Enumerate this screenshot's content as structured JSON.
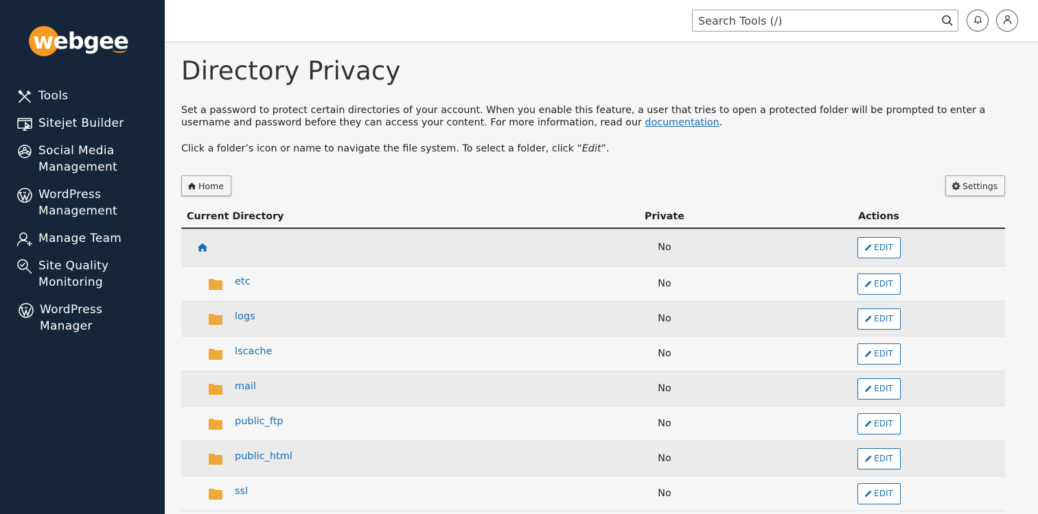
{
  "brand": {
    "name": "webgee",
    "accent": "#f59a23"
  },
  "sidebar": {
    "items": [
      {
        "label": "Tools",
        "icon": "tools-icon"
      },
      {
        "label": "Sitejet Builder",
        "icon": "sitejet-icon"
      },
      {
        "label": "Social Media Management",
        "icon": "social-media-icon"
      },
      {
        "label": "WordPress Management",
        "icon": "wordpress-icon"
      },
      {
        "label": "Manage Team",
        "icon": "manage-team-icon"
      },
      {
        "label": "Site Quality Monitoring",
        "icon": "site-quality-icon"
      },
      {
        "label": "WordPress Manager",
        "icon": "wordpress-icon"
      }
    ]
  },
  "header": {
    "search_placeholder": "Search Tools (/)",
    "search_value": ""
  },
  "main": {
    "title": "Directory Privacy",
    "description_before_link": "Set a password to protect certain directories of your account. When you enable this feature, a user that tries to open a protected folder will be prompted to enter a username and password before they can access your content. For more information, read our ",
    "description_link": "documentation",
    "description_after_link": ".",
    "instruction_before": "Click a folder’s icon or name to navigate the file system. To select a folder, click “",
    "instruction_em": "Edit",
    "instruction_after": "”.",
    "home_button": "Home",
    "settings_button": "Settings"
  },
  "table": {
    "headers": {
      "directory": "Current Directory",
      "private": "Private",
      "actions": "Actions"
    },
    "edit_label": "EDIT",
    "rows": [
      {
        "name": "",
        "is_home": true,
        "private": "No"
      },
      {
        "name": "etc",
        "private": "No"
      },
      {
        "name": "logs",
        "private": "No"
      },
      {
        "name": "lscache",
        "private": "No"
      },
      {
        "name": "mail",
        "private": "No"
      },
      {
        "name": "public_ftp",
        "private": "No"
      },
      {
        "name": "public_html",
        "private": "No"
      },
      {
        "name": "ssl",
        "private": "No"
      }
    ]
  }
}
